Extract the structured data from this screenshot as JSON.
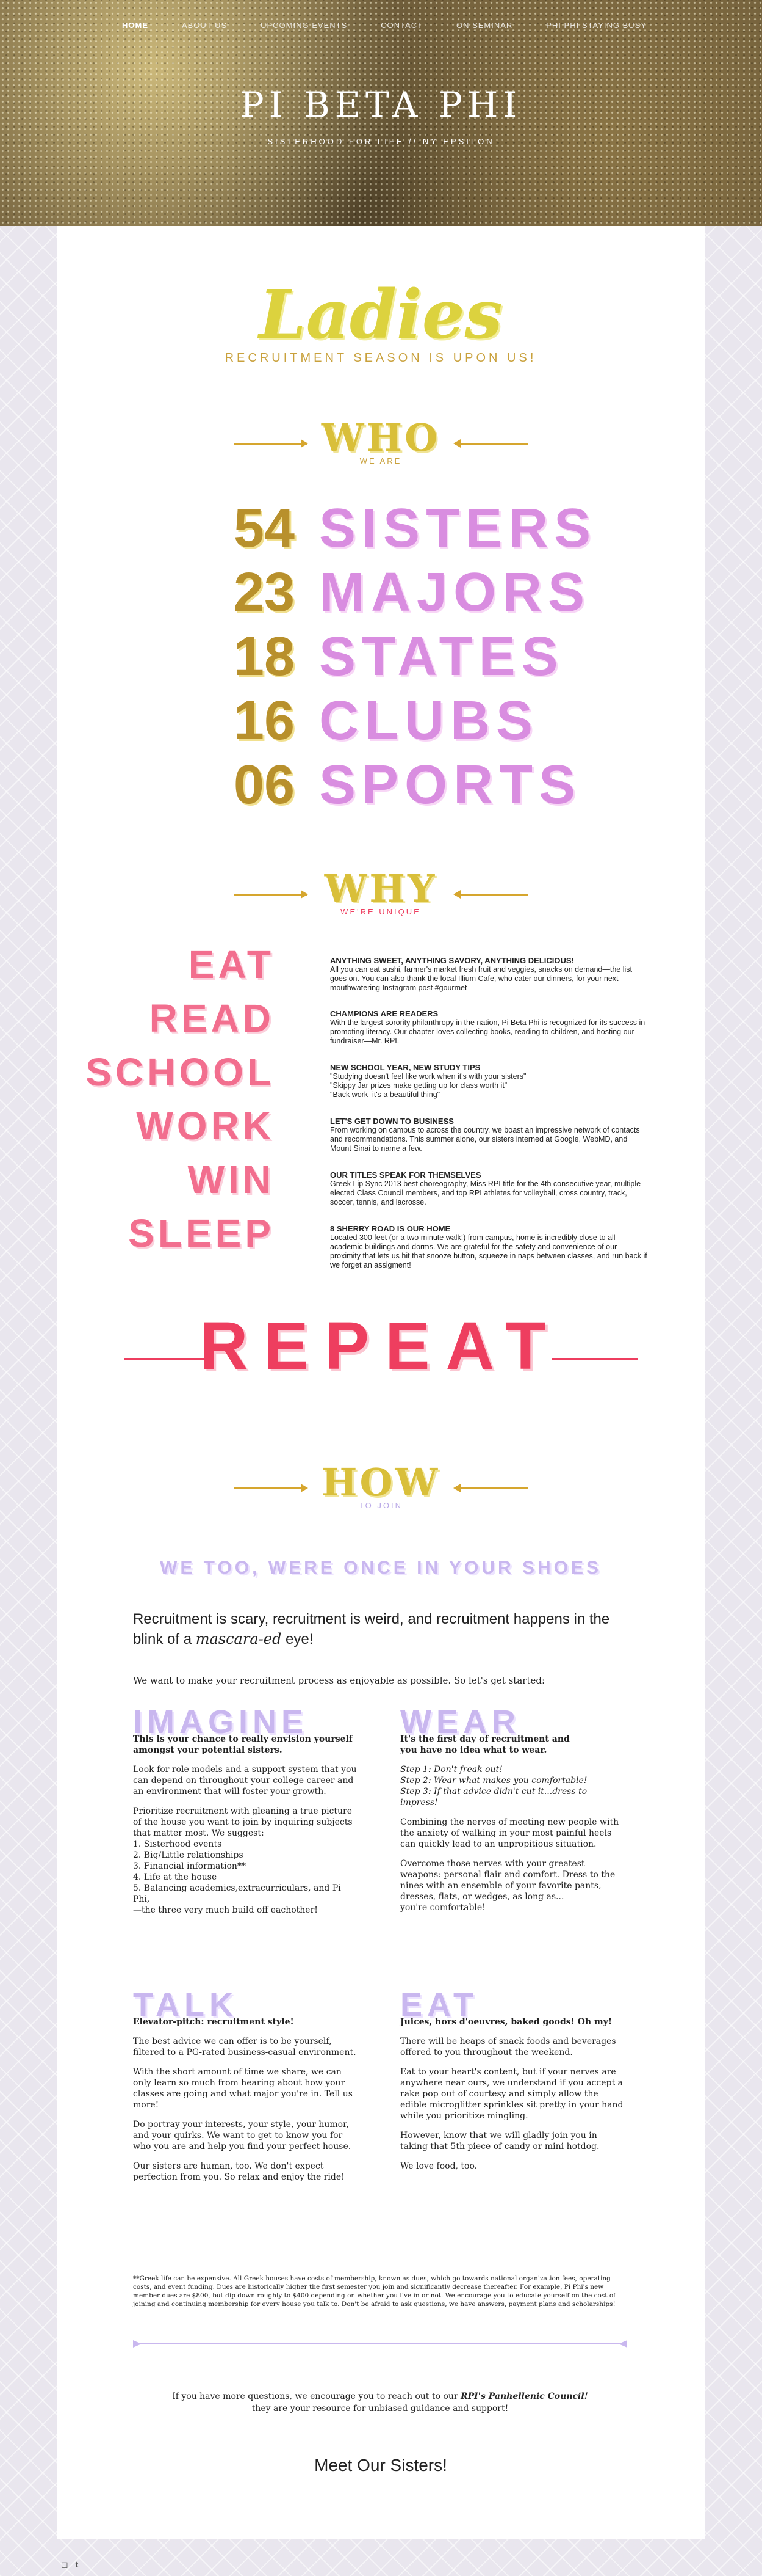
{
  "nav": [
    "HOME",
    "ABOUT US",
    "UPCOMING EVENTS",
    "CONTACT",
    "ON SEMINAR",
    "PHI PHI STAYING BUSY"
  ],
  "site": {
    "title": "PI BETA PHI",
    "tagline": "SISTERHOOD FOR LIFE // NY EPSILON"
  },
  "banner": {
    "title": "Ladies",
    "subtitle": "RECRUITMENT SEASON IS UPON US!"
  },
  "who": {
    "title": "WHO",
    "sub": "WE ARE",
    "stats": [
      {
        "num": "54",
        "label": "SISTERS"
      },
      {
        "num": "23",
        "label": "MAJORS"
      },
      {
        "num": "18",
        "label": "STATES"
      },
      {
        "num": "16",
        "label": "CLUBS"
      },
      {
        "num": "06",
        "label": "SPORTS"
      }
    ]
  },
  "why": {
    "title": "WHY",
    "sub": "WE'RE UNIQUE",
    "verbs": [
      "EAT",
      "READ",
      "SCHOOL",
      "WORK",
      "WIN",
      "SLEEP"
    ],
    "facts": [
      {
        "h": "ANYTHING SWEET, ANYTHING SAVORY, ANYTHING DELICIOUS!",
        "t": "All you can eat sushi, farmer's market fresh fruit and veggies, snacks on demand—the list goes on. You can also thank the local Illium Cafe, who cater our dinners, for your next mouthwatering Instagram post #gourmet"
      },
      {
        "h": "CHAMPIONS ARE READERS",
        "t": "With the largest sorority philanthropy in the nation, Pi Beta Phi is recognized for its success in promoting literacy. Our chapter loves collecting books, reading to children, and hosting our fundraiser—Mr. RPI."
      },
      {
        "h": "NEW SCHOOL YEAR, NEW STUDY TIPS",
        "t": "\"Studying doesn't feel like work when it's with your sisters\"\n\"Skippy Jar prizes make getting up for class worth it\"\n\"Back work–it's a beautiful thing\""
      },
      {
        "h": "LET'S GET DOWN TO BUSINESS",
        "t": "From working on campus to across the country, we boast an impressive network of contacts and recommendations. This summer alone, our sisters interned at Google, WebMD, and Mount Sinai to name a few."
      },
      {
        "h": "OUR TITLES SPEAK FOR THEMSELVES",
        "t": "Greek Lip Sync 2013 best choreography, Miss RPI title for the 4th consecutive year, multiple elected Class Council members, and top RPI athletes for volleyball, cross country, track, soccer, tennis, and lacrosse."
      },
      {
        "h": "8 SHERRY ROAD IS OUR HOME",
        "t": "Located 300 feet (or a two minute walk!) from campus, home is incredibly close to all academic buildings and dorms. We are grateful for the safety and convenience of our proximity that lets us hit that snooze button, squeeze in naps between classes, and run back if we forget an assigment!"
      }
    ]
  },
  "repeat": "REPEAT",
  "how": {
    "title": "HOW",
    "sub": "TO JOIN"
  },
  "shoes": "WE TOO, WERE ONCE IN YOUR SHOES",
  "lead": {
    "pre": "Recruitment is scary, recruitment is weird, and recruitment happens in the blink of a ",
    "em": "mascara-ed",
    "post": " eye!",
    "sub": "We want to make your recruitment process as enjoyable as possible. So let's get started:"
  },
  "cols": [
    {
      "h": "IMAGINE",
      "lead": "This is your chance to really envision yourself amongst your potential sisters.",
      "ps": [
        "Look for role models and a support system that you can depend on throughout your college career and an environment that will foster your growth.",
        "Prioritize recruitment with gleaning a true picture of the house you want to join by inquiring subjects that matter most. We suggest:\n1. Sisterhood events\n2. Big/Little relationships\n3. Financial information**\n4. Life at the house\n5. Balancing academics,extracurriculars, and Pi Phi,\n     —the three very much build off eachother!"
      ]
    },
    {
      "h": "WEAR",
      "lead": "It's the first day of recruitment and\nyou have no idea what to wear.",
      "ps": [
        "Step 1: Don't freak out!\nStep 2: Wear what makes you comfortable!\nStep 3: If that advice didn't cut it...dress to impress!",
        "Combining the nerves of meeting new people with the anxiety of walking in your most painful heels can quickly lead to an unpropitious situation.",
        "Overcome those nerves with your greatest weapons: personal flair and comfort. Dress to the nines with an ensemble of your favorite pants, dresses, flats, or wedges, as long as...\nyou're comfortable!"
      ]
    },
    {
      "h": "TALK",
      "lead": "Elevator-pitch: recruitment style!",
      "ps": [
        "The best advice we can offer is to be yourself, filtered to a PG-rated business-casual environment.",
        "With the short amount of time we share, we can only learn so much from hearing about how your classes are going and what major you're in. Tell us more!",
        "Do portray your interests, your style, your humor, and your quirks. We want to get to know you for who you are and help you find your perfect house.",
        "Our sisters are human, too. We don't expect perfection from you. So relax and enjoy the ride!"
      ]
    },
    {
      "h": "EAT",
      "lead": "Juices, hors d'oeuvres, baked goods! Oh my!",
      "ps": [
        "There will be heaps of snack foods and beverages offered to you throughout the weekend.",
        "Eat to your heart's content, but if your nerves are anywhere near ours, we understand if you accept a rake pop out of courtesy and simply allow the edible microglitter sprinkles sit pretty in your hand while you prioritize mingling.",
        "However, know that we will gladly join you in taking that 5th piece of candy or mini hotdog.",
        "We love food, too."
      ]
    }
  ],
  "footnote": "**Greek life can be expensive. All Greek houses have costs of membership, known as dues, which go towards national organization fees, operating costs, and event funding. Dues are historically higher the first semester you join and significantly decrease thereafter. For example, Pi Phi's new member dues are $800, but dip down roughly to $400 depending on whether you live in or not. We encourage you to educate yourself on the cost of joining and continuing membership for every house you talk to. Don't be afraid to ask questions, we have answers, payment plans and scholarships!",
  "contact": {
    "pre": "If you have more questions, we encourage you to reach out to our ",
    "em": "RPI's Panhellenic Council!",
    "line2": "they are your resource for unbiased guidance and support!"
  },
  "meet": "Meet Our Sisters!",
  "social": [
    "instagram-icon",
    "tumblr-icon"
  ]
}
